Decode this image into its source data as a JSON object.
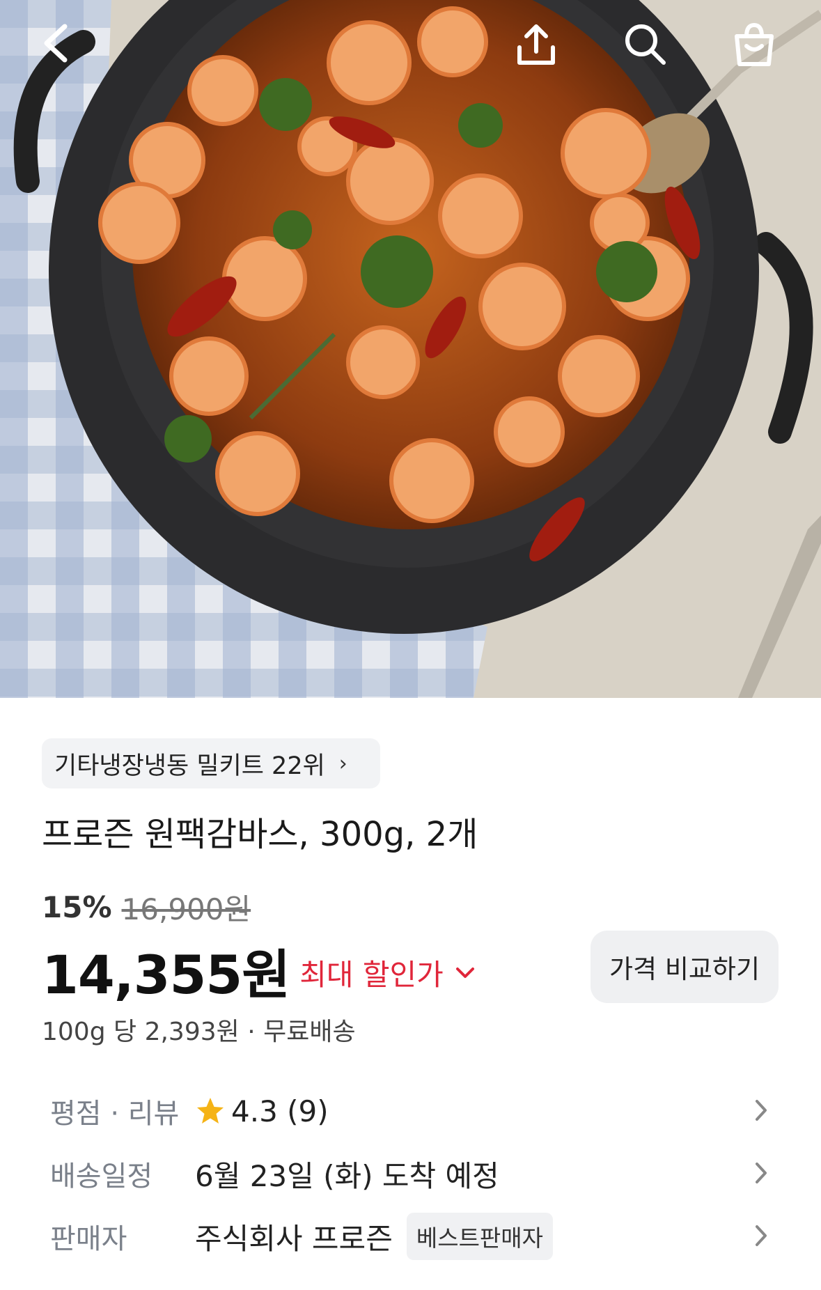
{
  "header": {
    "back_icon": "chevron-left-icon",
    "share_icon": "share-icon",
    "search_icon": "search-icon",
    "cart_icon": "shopping-bag-icon"
  },
  "product": {
    "rank_label": "기타냉장냉동 밀키트 22위",
    "title": "프로즌 원팩감바스, 300g, 2개",
    "discount_rate": "15%",
    "original_price": "16,900원",
    "price": "14,355원",
    "max_discount_label": "최대 할인가",
    "compare_button": "가격 비교하기",
    "unit_price": "100g 당 2,393원 · 무료배송"
  },
  "info_rows": {
    "rating_label": "평점 · 리뷰",
    "rating_value": "4.3 (9)",
    "delivery_label": "배송일정",
    "delivery_value": "6월 23일 (화) 도착 예정",
    "seller_label": "판매자",
    "seller_value": "주식회사 프로즌",
    "seller_badge": "베스트판매자"
  },
  "colors": {
    "accent_red": "#e0263a",
    "star": "#f5b316",
    "chip_bg": "#f2f3f5"
  }
}
